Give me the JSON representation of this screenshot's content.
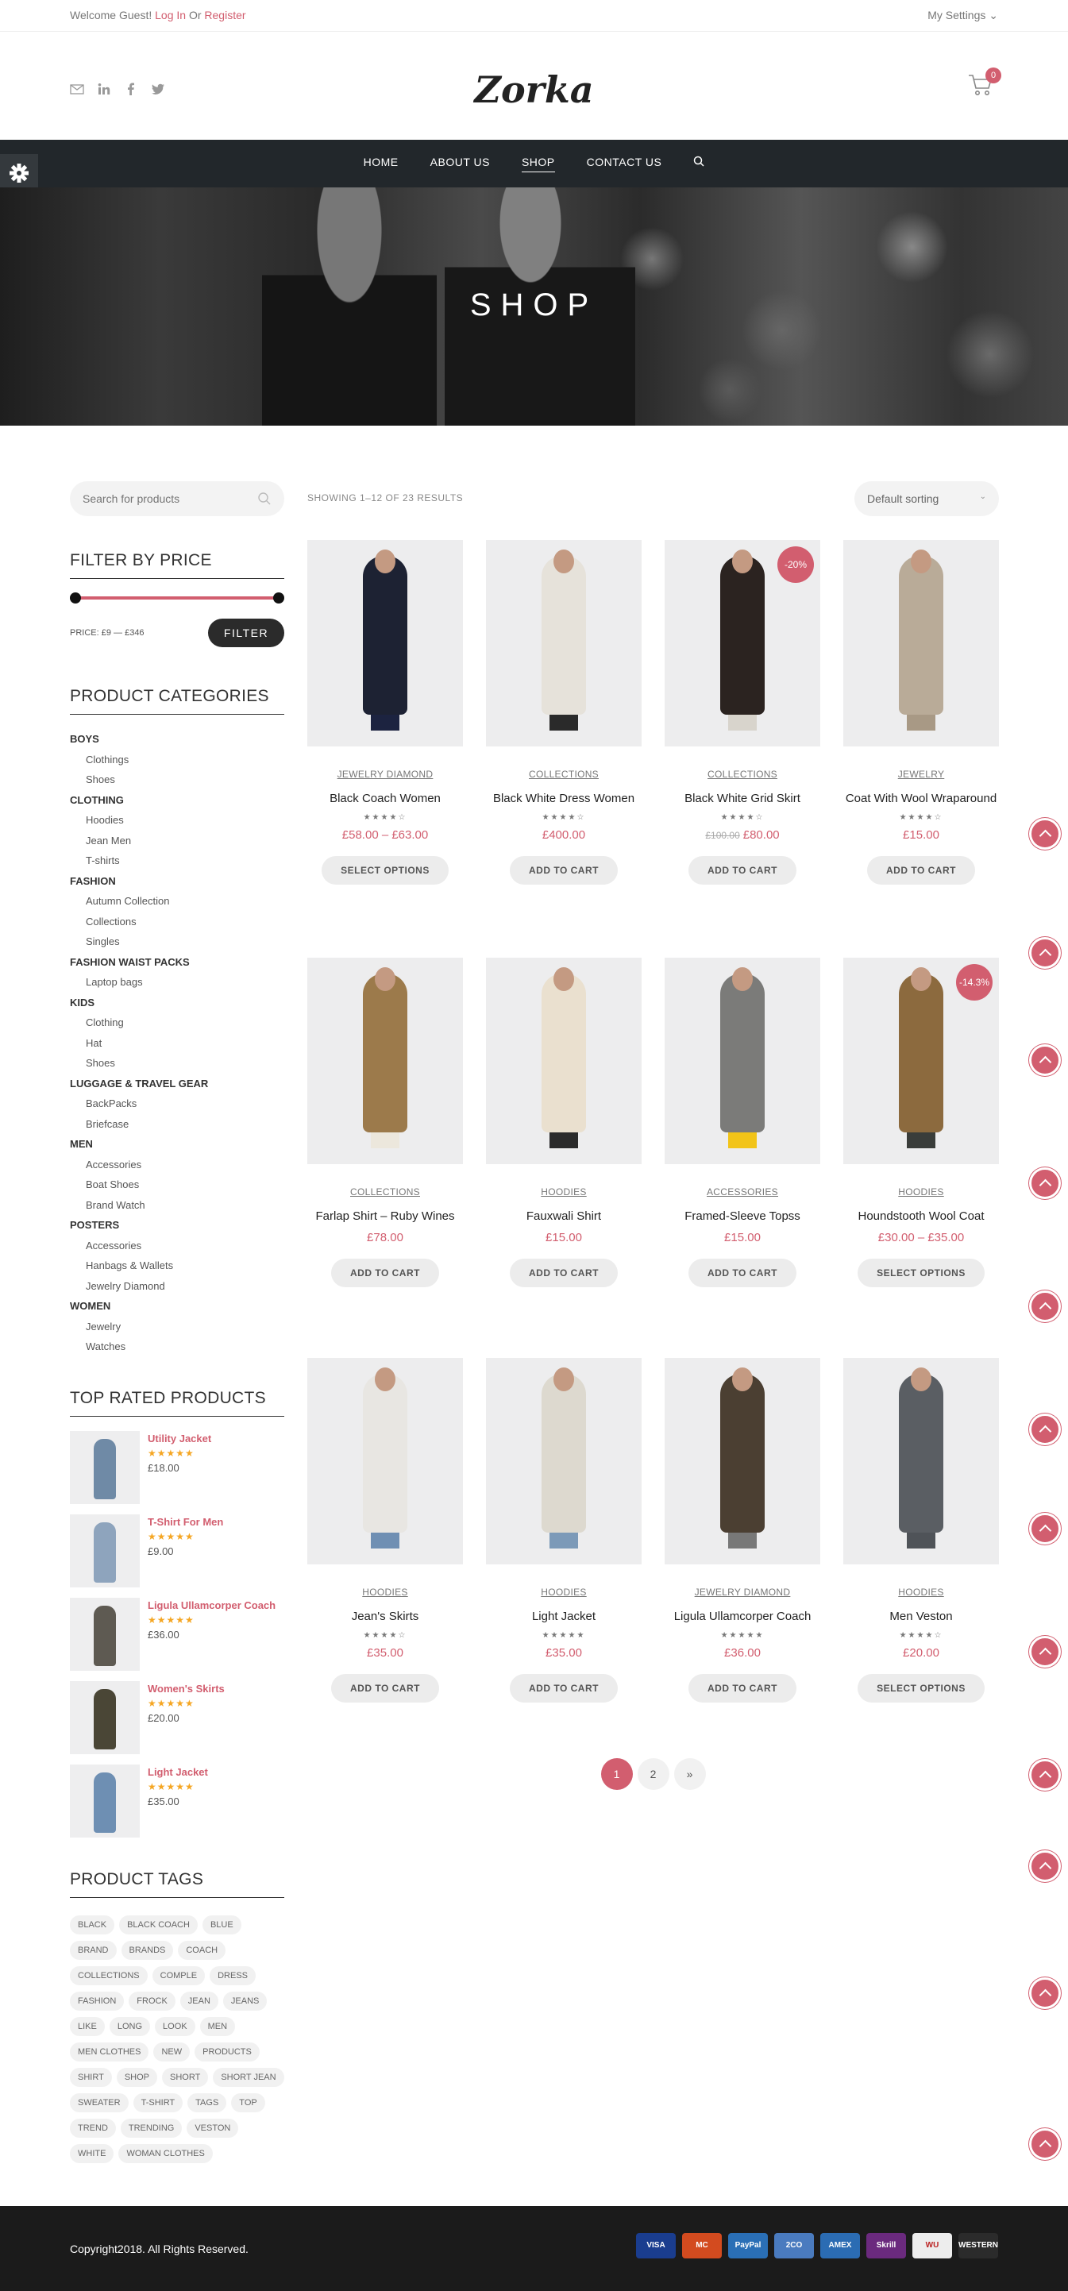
{
  "topbar": {
    "welcome": "Welcome Guest!",
    "login": "Log In",
    "or": "Or",
    "register": "Register",
    "settings": "My Settings ⌄"
  },
  "header": {
    "logo": "Zorka",
    "cart_count": "0"
  },
  "nav": {
    "items": [
      "HOME",
      "ABOUT US",
      "SHOP",
      "CONTACT US"
    ],
    "active": "SHOP"
  },
  "hero": {
    "title": "SHOP"
  },
  "sidebar": {
    "search_placeholder": "Search for products",
    "price_title": "FILTER BY PRICE",
    "price_label": "PRICE: £9 — £346",
    "filter_button": "FILTER",
    "categories_title": "PRODUCT CATEGORIES",
    "categories": [
      {
        "label": "BOYS",
        "parent": true
      },
      {
        "label": "Clothings"
      },
      {
        "label": "Shoes"
      },
      {
        "label": "CLOTHING",
        "parent": true
      },
      {
        "label": "Hoodies"
      },
      {
        "label": "Jean Men"
      },
      {
        "label": "T-shirts"
      },
      {
        "label": "FASHION",
        "parent": true
      },
      {
        "label": "Autumn Collection"
      },
      {
        "label": "Collections"
      },
      {
        "label": "Singles"
      },
      {
        "label": "FASHION WAIST PACKS",
        "parent": true
      },
      {
        "label": "Laptop bags"
      },
      {
        "label": "KIDS",
        "parent": true
      },
      {
        "label": "Clothing"
      },
      {
        "label": "Hat"
      },
      {
        "label": "Shoes"
      },
      {
        "label": "LUGGAGE & TRAVEL GEAR",
        "parent": true
      },
      {
        "label": "BackPacks"
      },
      {
        "label": "Briefcase"
      },
      {
        "label": "MEN",
        "parent": true
      },
      {
        "label": "Accessories"
      },
      {
        "label": "Boat Shoes"
      },
      {
        "label": "Brand Watch"
      },
      {
        "label": "POSTERS",
        "parent": true
      },
      {
        "label": "Accessories"
      },
      {
        "label": "Hanbags & Wallets"
      },
      {
        "label": "Jewelry Diamond"
      },
      {
        "label": "WOMEN",
        "parent": true
      },
      {
        "label": "Jewelry"
      },
      {
        "label": "Watches"
      }
    ],
    "top_title": "TOP RATED PRODUCTS",
    "top_rated": [
      {
        "name": "Utility Jacket",
        "stars": "★★★★★",
        "price": "£18.00",
        "color": "#6f8aa6"
      },
      {
        "name": "T-Shirt For Men",
        "stars": "★★★★★",
        "price": "£9.00",
        "color": "#8ea4bd"
      },
      {
        "name": "Ligula Ullamcorper Coach",
        "stars": "★★★★★",
        "price": "£36.00",
        "color": "#5e5a52"
      },
      {
        "name": "Women's Skirts",
        "stars": "★★★★★",
        "price": "£20.00",
        "color": "#4a4636"
      },
      {
        "name": "Light Jacket",
        "stars": "★★★★★",
        "price": "£35.00",
        "color": "#6e8fb3"
      }
    ],
    "tags_title": "PRODUCT TAGS",
    "tags": [
      "BLACK",
      "BLACK COACH",
      "BLUE",
      "BRAND",
      "BRANDS",
      "COACH",
      "COLLECTIONS",
      "COMPLE",
      "DRESS",
      "FASHION",
      "FROCK",
      "JEAN",
      "JEANS",
      "LIKE",
      "LONG",
      "LOOK",
      "MEN",
      "MEN CLOTHES",
      "NEW",
      "PRODUCTS",
      "SHIRT",
      "SHOP",
      "SHORT",
      "SHORT JEAN",
      "SWEATER",
      "T-SHIRT",
      "TAGS",
      "TOP",
      "TREND",
      "TRENDING",
      "VESTON",
      "WHITE",
      "WOMAN CLOTHES"
    ]
  },
  "main": {
    "results": "SHOWING 1–12 OF 23 RESULTS",
    "sorting": "Default sorting",
    "products": [
      {
        "cat": "JEWELRY DIAMOND",
        "title": "Black Coach Women",
        "rating": "★★★★☆",
        "price": "£58.00 – £63.00",
        "old": "",
        "sale": "",
        "btn": "SELECT OPTIONS",
        "body": "#1d2233",
        "legs": "#1c2340"
      },
      {
        "cat": "COLLECTIONS",
        "title": "Black White Dress Women",
        "rating": "★★★★☆",
        "price": "£400.00",
        "old": "",
        "sale": "",
        "btn": "ADD TO CART",
        "body": "#e6e2da",
        "legs": "#2a2a2a"
      },
      {
        "cat": "COLLECTIONS",
        "title": "Black White Grid Skirt",
        "rating": "★★★★☆",
        "price": "£80.00",
        "old": "£100.00",
        "sale": "-20%",
        "btn": "ADD TO CART",
        "body": "#2b2320",
        "legs": "#d8d4cc"
      },
      {
        "cat": "JEWELRY",
        "title": "Coat With Wool Wraparound",
        "rating": "★★★★☆",
        "price": "£15.00",
        "old": "",
        "sale": "",
        "btn": "ADD TO CART",
        "body": "#b9ab98",
        "legs": "#a89985"
      },
      {
        "cat": "COLLECTIONS",
        "title": "Farlap Shirt – Ruby Wines",
        "rating": "",
        "price": "£78.00",
        "old": "",
        "sale": "",
        "btn": "ADD TO CART",
        "body": "#9c7a4b",
        "legs": "#ece7dc"
      },
      {
        "cat": "HOODIES",
        "title": "Fauxwali Shirt",
        "rating": "",
        "price": "£15.00",
        "old": "",
        "sale": "",
        "btn": "ADD TO CART",
        "body": "#eae0cf",
        "legs": "#2b2b2b"
      },
      {
        "cat": "ACCESSORIES",
        "title": "Framed-Sleeve Topss",
        "rating": "",
        "price": "£15.00",
        "old": "",
        "sale": "",
        "btn": "ADD TO CART",
        "body": "#7b7b79",
        "legs": "#f2c418"
      },
      {
        "cat": "HOODIES",
        "title": "Houndstooth Wool Coat",
        "rating": "",
        "price": "£30.00 – £35.00",
        "old": "",
        "sale": "-14.3%",
        "btn": "SELECT OPTIONS",
        "body": "#8c6a3e",
        "legs": "#3a3d3a"
      },
      {
        "cat": "HOODIES",
        "title": "Jean's Skirts",
        "rating": "★★★★☆",
        "price": "£35.00",
        "old": "",
        "sale": "",
        "btn": "ADD TO CART",
        "body": "#e8e6e2",
        "legs": "#6f8fb3"
      },
      {
        "cat": "HOODIES",
        "title": "Light Jacket",
        "rating": "★★★★★",
        "price": "£35.00",
        "old": "",
        "sale": "",
        "btn": "ADD TO CART",
        "body": "#ddd9cf",
        "legs": "#7c9ab8"
      },
      {
        "cat": "JEWELRY DIAMOND",
        "title": "Ligula Ullamcorper Coach",
        "rating": "★★★★★",
        "price": "£36.00",
        "old": "",
        "sale": "",
        "btn": "ADD TO CART",
        "body": "#4b3f32",
        "legs": "#787878"
      },
      {
        "cat": "HOODIES",
        "title": "Men Veston",
        "rating": "★★★★☆",
        "price": "£20.00",
        "old": "",
        "sale": "",
        "btn": "SELECT OPTIONS",
        "body": "#5a5e63",
        "legs": "#4f5358"
      }
    ],
    "pages": [
      "1",
      "2",
      "»"
    ]
  },
  "footer": {
    "copyright": "Copyright2018. All Rights Reserved.",
    "payments": [
      {
        "label": "VISA",
        "color": "#1a3d8f"
      },
      {
        "label": "MC",
        "color": "#d34b1f"
      },
      {
        "label": "PayPal",
        "color": "#2a6fb6"
      },
      {
        "label": "2CO",
        "color": "#4a7bbf"
      },
      {
        "label": "AMEX",
        "color": "#2b6cb3"
      },
      {
        "label": "Skrill",
        "color": "#6b2a7e"
      },
      {
        "label": "WU",
        "color": "#ededed"
      },
      {
        "label": "WESTERN",
        "color": "#2b2b2b"
      }
    ]
  },
  "theme": {
    "accent": "#d25e6f",
    "nav_bg": "#22272b",
    "footer_bg": "#1b1b1b"
  }
}
